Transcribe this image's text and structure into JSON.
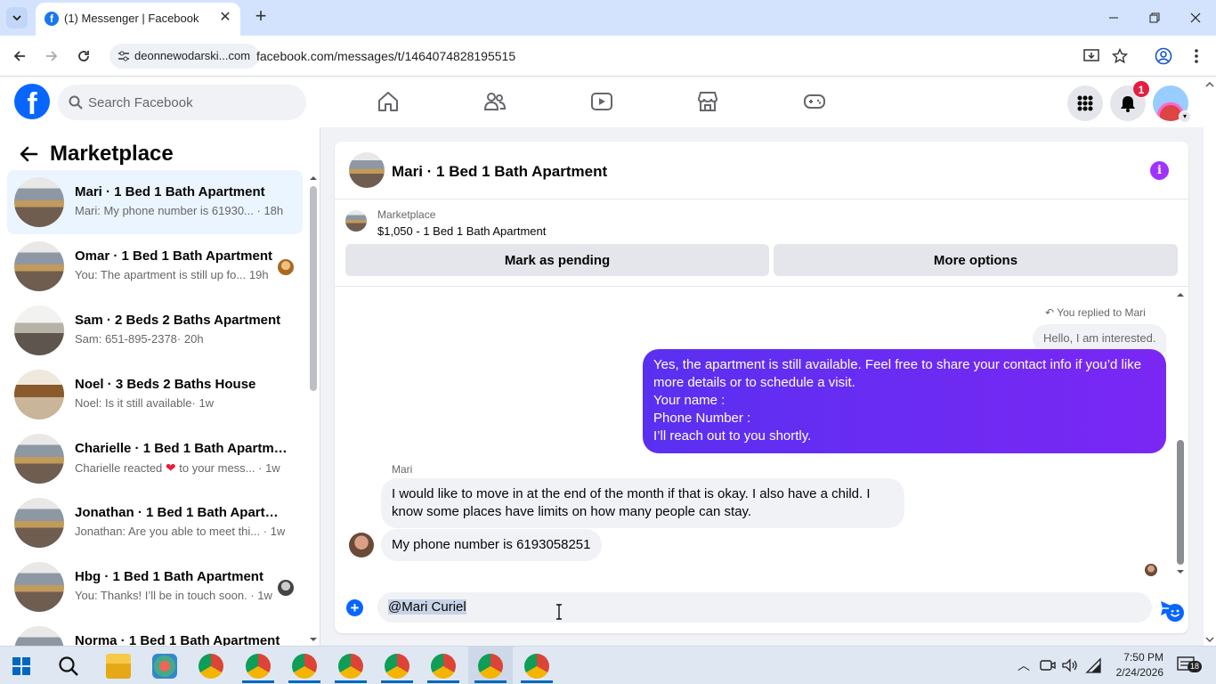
{
  "browser": {
    "tab_title": "(1) Messenger | Facebook",
    "site_chip": "deonnewodarski...com",
    "url": "facebook.com/messages/t/1464074828195515"
  },
  "fb_header": {
    "search_placeholder": "Search Facebook",
    "notification_count": "1"
  },
  "sidebar": {
    "title": "Marketplace",
    "conversations": [
      {
        "name": "Mari · 1 Bed 1 Bath Apartment",
        "preview": "Mari: My phone number is 61930...",
        "time": "· 18h",
        "active": true
      },
      {
        "name": "Omar · 1 Bed 1 Bath Apartment",
        "preview": "You: The apartment is still up fo...",
        "time": "19h"
      },
      {
        "name": "Sam · 2 Beds 2 Baths Apartment",
        "preview": "Sam: 651-895-2378",
        "time": "· 20h"
      },
      {
        "name": "Noel · 3 Beds 2 Baths House",
        "preview": "Noel: Is it still available",
        "time": "· 1w"
      },
      {
        "name": "Charielle · 1 Bed 1 Bath Apartment",
        "preview_a": "Charielle reacted",
        "preview_b": "to your mess...",
        "time": "· 1w"
      },
      {
        "name": "Jonathan · 1 Bed 1 Bath Apartme...",
        "preview": "Jonathan: Are you able to meet thi...",
        "time": "· 1w"
      },
      {
        "name": "Hbg · 1 Bed 1 Bath Apartment",
        "preview": "You: Thanks! I’ll be in touch soon.",
        "time": "· 1w"
      },
      {
        "name": "Norma · 1 Bed 1 Bath Apartment",
        "preview": "",
        "time": ""
      }
    ]
  },
  "chat": {
    "title": "Mari · 1 Bed 1 Bath Apartment",
    "listing_label": "Marketplace",
    "listing_price": "$1,050 - 1 Bed 1 Bath Apartment",
    "btn_pending": "Mark as pending",
    "btn_more": "More options",
    "replied_label": "You replied to Mari",
    "quoted_text": "Hello, I am interested.",
    "outgoing_lines": [
      "Yes, the apartment is still available. Feel free to share your contact info if you’d like",
      "more details or to schedule a visit.",
      "Your name :",
      "Phone Number :",
      "I’ll reach out to you shortly."
    ],
    "sender_name": "Mari",
    "incoming_1_lines": [
      "I would like to move in at the end of the month if that is okay. I also have a child. I",
      "know some places have limits on how many people can stay."
    ],
    "incoming_2": "My phone number is 6193058251",
    "compose_text": "@Mari Curiel"
  },
  "taskbar": {
    "time": "7:50 PM",
    "date": "2/24/2026",
    "notif_count": "18"
  }
}
